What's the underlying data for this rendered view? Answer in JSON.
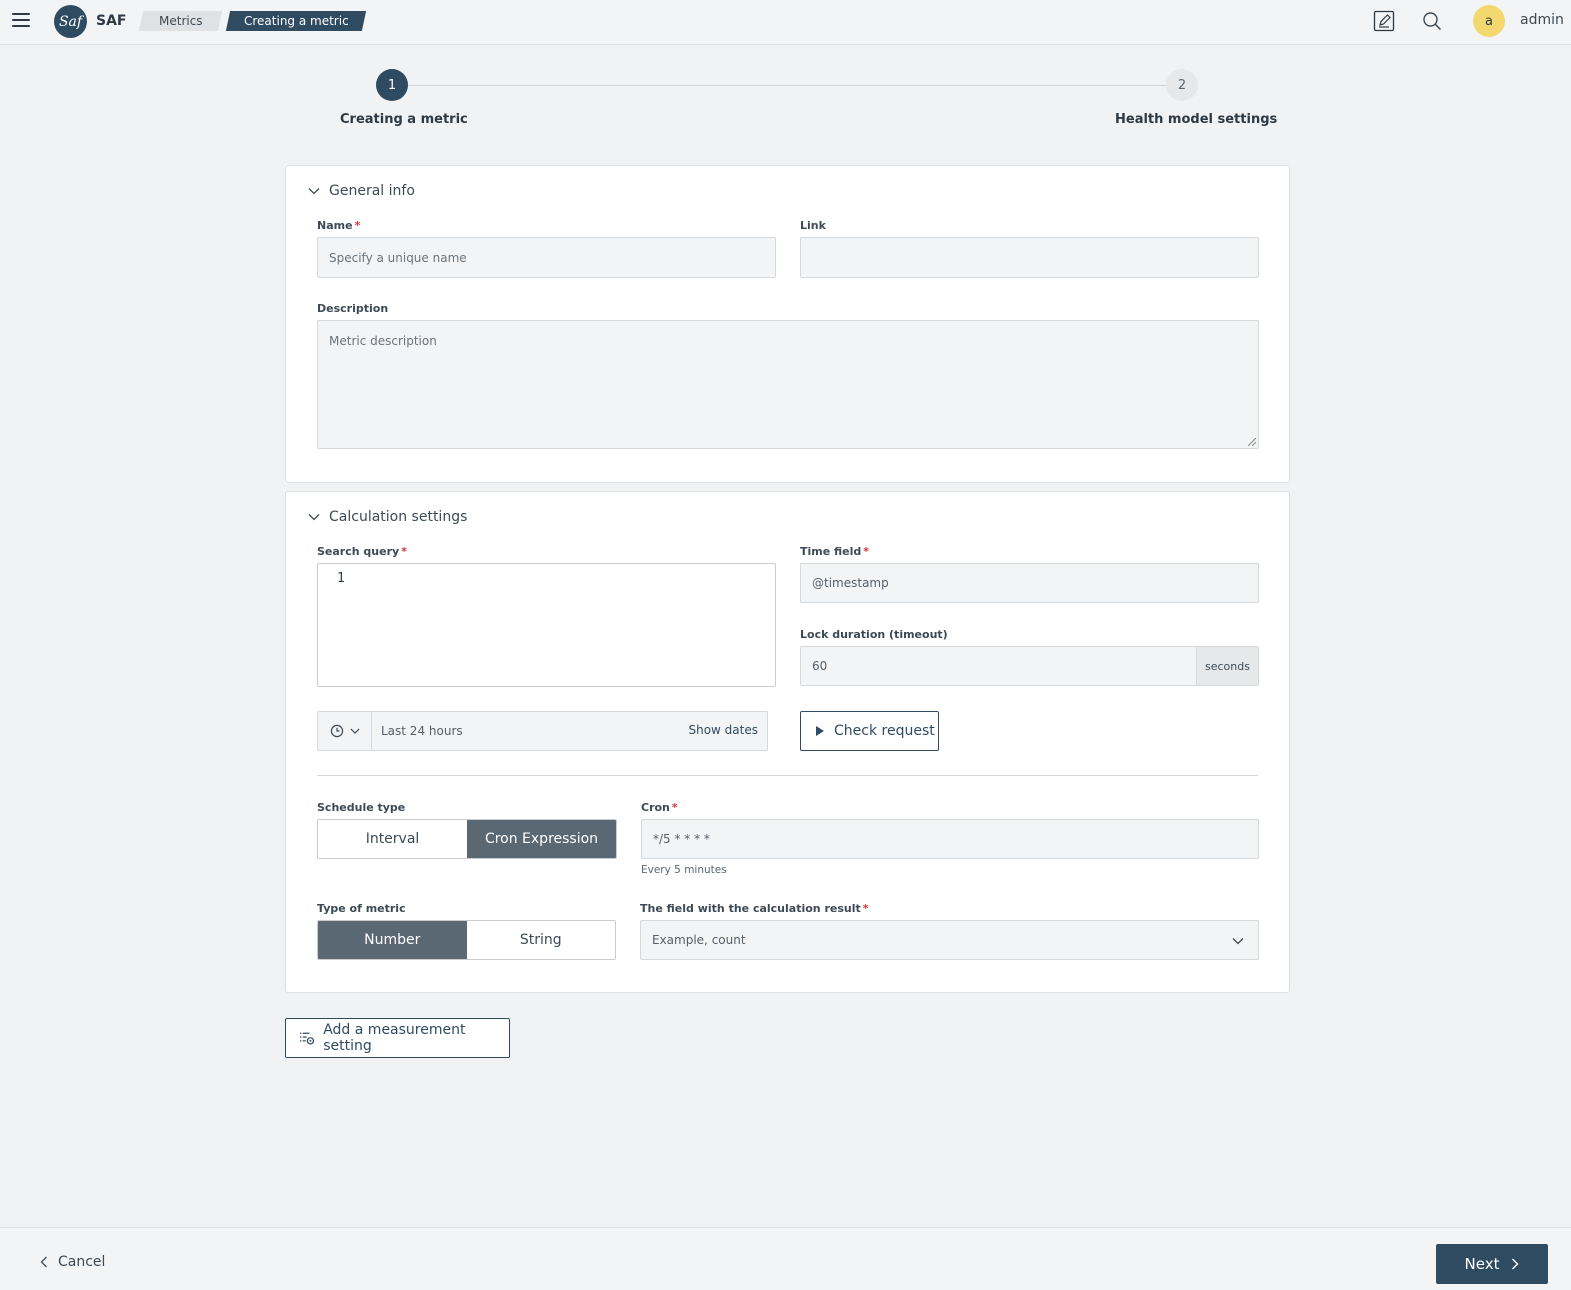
{
  "header": {
    "app_name": "SAF",
    "logo_text": "Saf",
    "breadcrumbs": [
      "Metrics",
      "Creating a metric"
    ],
    "avatar_letter": "a",
    "user_name": "admin"
  },
  "stepper": {
    "steps": [
      {
        "number": "1",
        "label": "Creating a metric",
        "active": true
      },
      {
        "number": "2",
        "label": "Health model settings",
        "active": false
      }
    ]
  },
  "general_info": {
    "title": "General info",
    "name_label": "Name",
    "name_placeholder": "Specify a unique name",
    "link_label": "Link",
    "link_value": "",
    "description_label": "Description",
    "description_placeholder": "Metric description"
  },
  "calculation": {
    "title": "Calculation settings",
    "search_query_label": "Search query",
    "line_number": "1",
    "time_field_label": "Time field",
    "time_field_value": "@timestamp",
    "lock_label": "Lock duration (timeout)",
    "lock_value": "60",
    "lock_unit": "seconds",
    "time_range": "Last 24 hours",
    "show_dates": "Show dates",
    "check_request": "Check request",
    "schedule_label": "Schedule type",
    "schedule_options": [
      "Interval",
      "Cron Expression"
    ],
    "schedule_selected": "Cron Expression",
    "cron_label": "Cron",
    "cron_value": "*/5 * * * *",
    "cron_hint": "Every 5 minutes",
    "metric_type_label": "Type of metric",
    "metric_type_options": [
      "Number",
      "String"
    ],
    "metric_type_selected": "Number",
    "result_field_label": "The field with the calculation result",
    "result_field_value": "Example, count"
  },
  "actions": {
    "add_measurement": "Add a measurement setting",
    "cancel": "Cancel",
    "next": "Next"
  },
  "colors": {
    "primary": "#2f4b62",
    "segment_active": "#5a6873",
    "required": "#dd3333",
    "avatar": "#f3d870"
  }
}
